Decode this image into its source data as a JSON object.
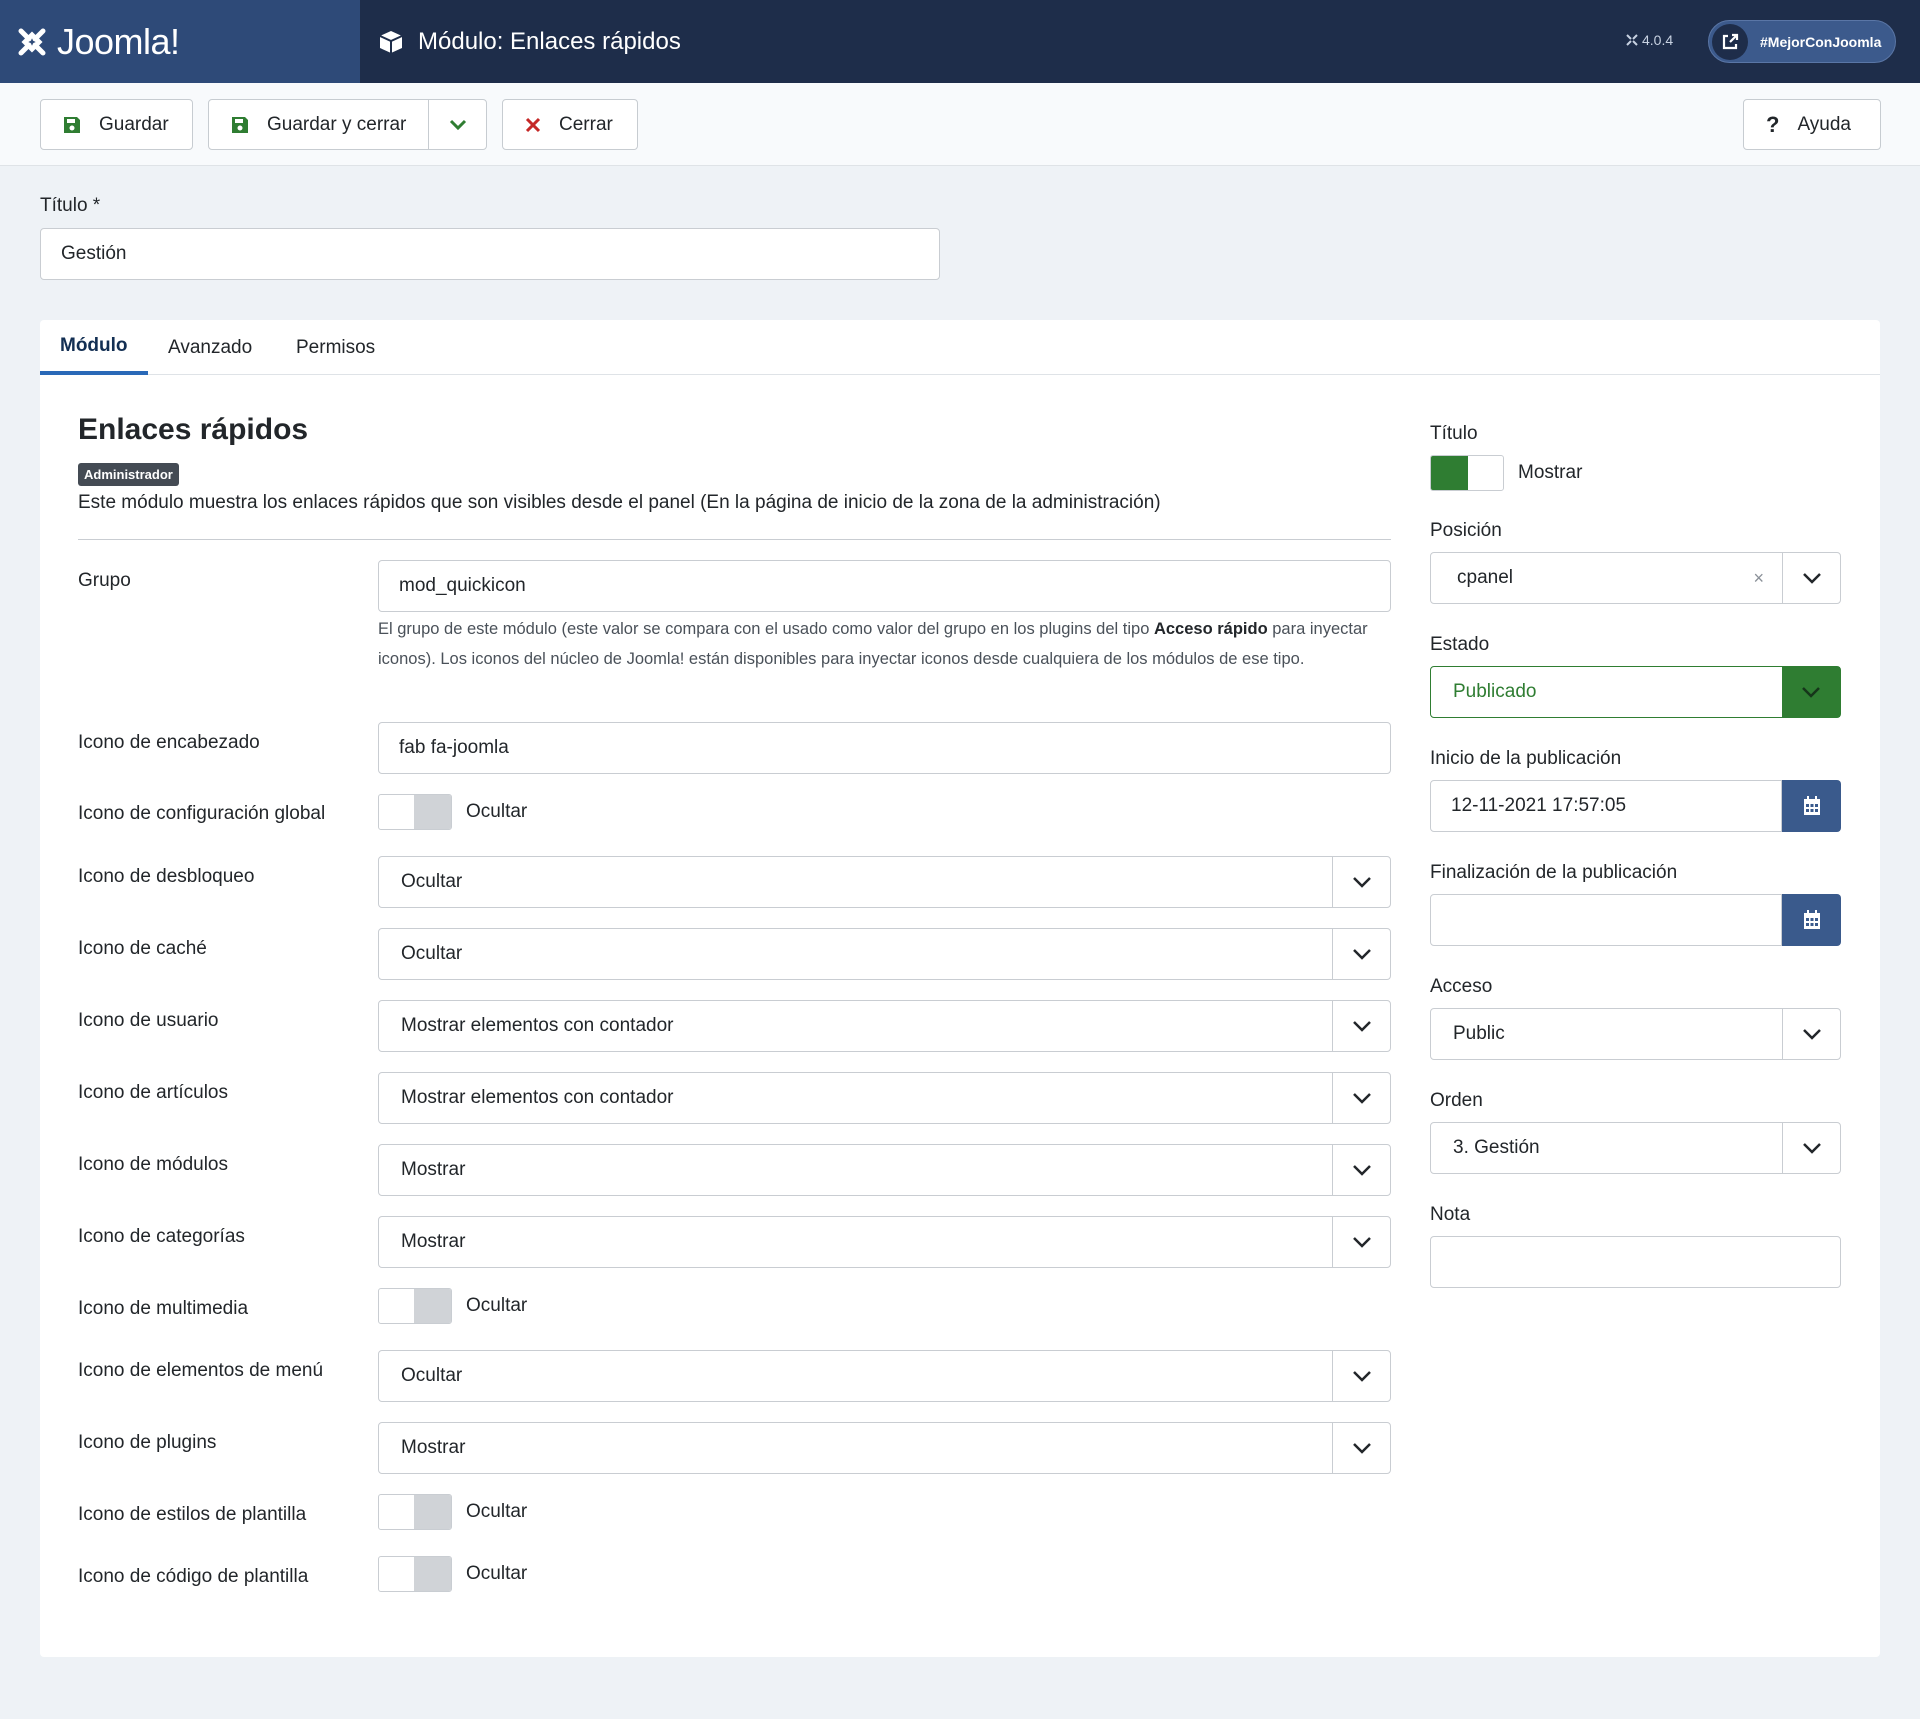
{
  "header": {
    "logo_text": "Joomla!",
    "title": "Módulo: Enlaces rápidos",
    "version": "4.0.4",
    "hashtag": "#MejorConJoomla"
  },
  "toolbar": {
    "save": "Guardar",
    "save_close": "Guardar y cerrar",
    "close": "Cerrar",
    "help": "Ayuda"
  },
  "title_field": {
    "label": "Título *",
    "value": "Gestión"
  },
  "tabs": [
    "Módulo",
    "Avanzado",
    "Permisos"
  ],
  "module": {
    "heading": "Enlaces rápidos",
    "badge": "Administrador",
    "description": "Este módulo muestra los enlaces rápidos que son visibles desde el panel (En la página de inicio de la zona de la administración)",
    "group_help_1": "El grupo de este módulo (este valor se compara con el usado como valor del grupo en los plugins del tipo ",
    "group_help_bold": "Acceso rápido",
    "group_help_2": " para inyectar iconos). Los iconos del núcleo de Joomla! están disponibles para inyectar iconos desde cualquiera de los módulos de ese tipo."
  },
  "fields": {
    "grupo": {
      "label": "Grupo",
      "value": "mod_quickicon"
    },
    "icono_encabezado": {
      "label": "Icono de encabezado",
      "value": "fab fa-joomla"
    },
    "config_global": {
      "label": "Icono de configuración global",
      "value": "Ocultar"
    },
    "desbloqueo": {
      "label": "Icono de desbloqueo",
      "value": "Ocultar"
    },
    "cache": {
      "label": "Icono de caché",
      "value": "Ocultar"
    },
    "usuario": {
      "label": "Icono de usuario",
      "value": "Mostrar elementos con contador"
    },
    "articulos": {
      "label": "Icono de artículos",
      "value": "Mostrar elementos con contador"
    },
    "modulos": {
      "label": "Icono de módulos",
      "value": "Mostrar"
    },
    "categorias": {
      "label": "Icono de categorías",
      "value": "Mostrar"
    },
    "multimedia": {
      "label": "Icono de multimedia",
      "value": "Ocultar"
    },
    "menu": {
      "label": "Icono de elementos de menú",
      "value": "Ocultar"
    },
    "plugins": {
      "label": "Icono de plugins",
      "value": "Mostrar"
    },
    "estilos": {
      "label": "Icono de estilos de plantilla",
      "value": "Ocultar"
    },
    "codigo": {
      "label": "Icono de código de plantilla",
      "value": "Ocultar"
    }
  },
  "sidebar": {
    "titulo": {
      "label": "Título",
      "value": "Mostrar"
    },
    "posicion": {
      "label": "Posición",
      "value": "cpanel",
      "clear": "×"
    },
    "estado": {
      "label": "Estado",
      "value": "Publicado"
    },
    "inicio": {
      "label": "Inicio de la publicación",
      "value": "12-11-2021 17:57:05"
    },
    "fin": {
      "label": "Finalización de la publicación",
      "value": ""
    },
    "acceso": {
      "label": "Acceso",
      "value": "Public"
    },
    "orden": {
      "label": "Orden",
      "value": "3. Gestión"
    },
    "nota": {
      "label": "Nota",
      "value": ""
    }
  },
  "colors": {
    "header": "#1e2d4a",
    "logo_bg": "#2e4a78",
    "published": "#2f7d32",
    "calendar_btn": "#3a5a8c"
  }
}
